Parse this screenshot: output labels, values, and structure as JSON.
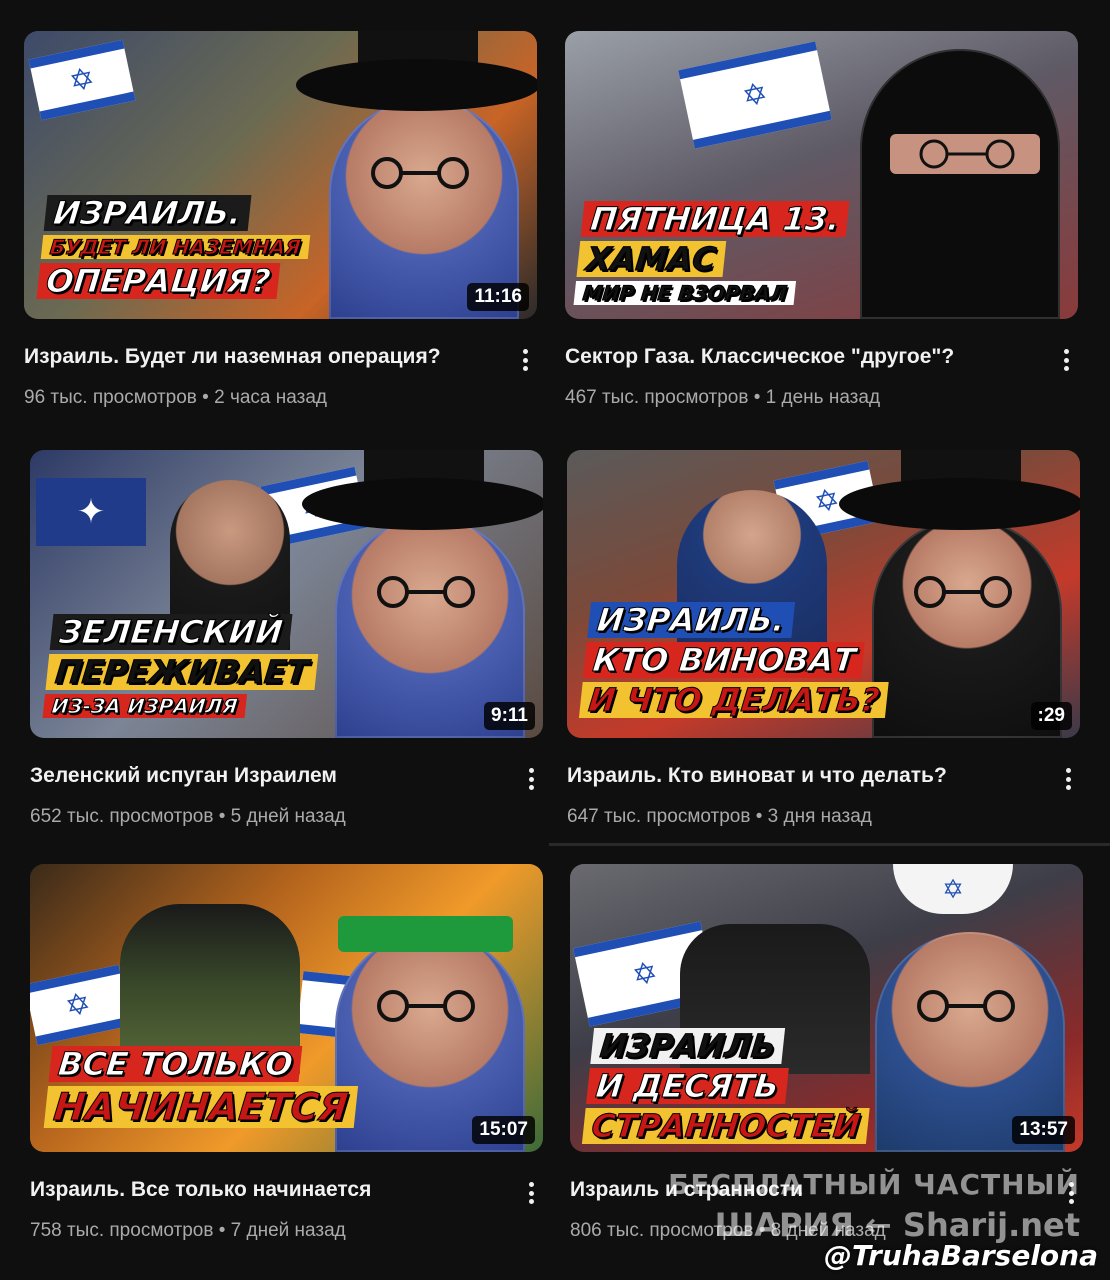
{
  "videos": [
    {
      "title": "Израиль. Будет ли наземная операция?",
      "meta": "96 тыс. просмотров • 2 часа назад",
      "duration": "11:16",
      "caption": [
        "ИЗРАИЛЬ.",
        "БУДЕТ ЛИ НАЗЕМНАЯ",
        "ОПЕРАЦИЯ?"
      ],
      "bg": "#7a6a4e",
      "accent": "#c25b1f"
    },
    {
      "title": "Сектор Газа. Классическое \"другое\"?",
      "meta": "467 тыс. просмотров • 1 день назад",
      "duration": "",
      "caption": [
        "ПЯТНИЦА 13.",
        "ХАМАС",
        "МИР НЕ ВЗОРВАЛ"
      ],
      "bg": "#5a5a6a",
      "accent": "#d7261e"
    },
    {
      "title": "Зеленский испуган Израилем",
      "meta": "652 тыс. просмотров • 5 дней назад",
      "duration": "9:11",
      "caption": [
        "ЗЕЛЕНСКИЙ",
        "ПЕРЕЖИВАЕТ",
        "ИЗ-ЗА ИЗРАИЛЯ"
      ],
      "bg": "#6e7686",
      "accent": "#d7261e"
    },
    {
      "title": "Израиль. Кто виноват и что делать?",
      "meta": "647 тыс. просмотров • 3 дня назад",
      "duration": ":29",
      "caption": [
        "ИЗРАИЛЬ.",
        "КТО ВИНОВАТ",
        "И ЧТО ДЕЛАТЬ?"
      ],
      "bg": "#3b4f7a",
      "accent": "#d7261e"
    },
    {
      "title": "Израиль. Все только начинается",
      "meta": "758 тыс. просмотров • 7 дней назад",
      "duration": "15:07",
      "caption": [
        "ВСЕ ТОЛЬКО",
        "НАЧИНАЕТСЯ"
      ],
      "bg": "#8a5a24",
      "accent": "#e0822a"
    },
    {
      "title": "Израиль и странности",
      "meta": "806 тыс. просмотров • 8 дней назад",
      "duration": "13:57",
      "caption": [
        "ИЗРАИЛЬ",
        "И ДЕСЯТЬ",
        "СТРАННОСТЕЙ"
      ],
      "bg": "#4d4e58",
      "accent": "#d7261e"
    }
  ],
  "watermark": {
    "line1": "БЕСПЛАТНЫЙ ЧАСТНЫЙ",
    "line2": "ШАРИЯ ← Sharij.net",
    "handle": "@TruhaBarselona"
  },
  "icons": {
    "menu": "more-vert-icon",
    "flag": "star-of-david-icon"
  }
}
